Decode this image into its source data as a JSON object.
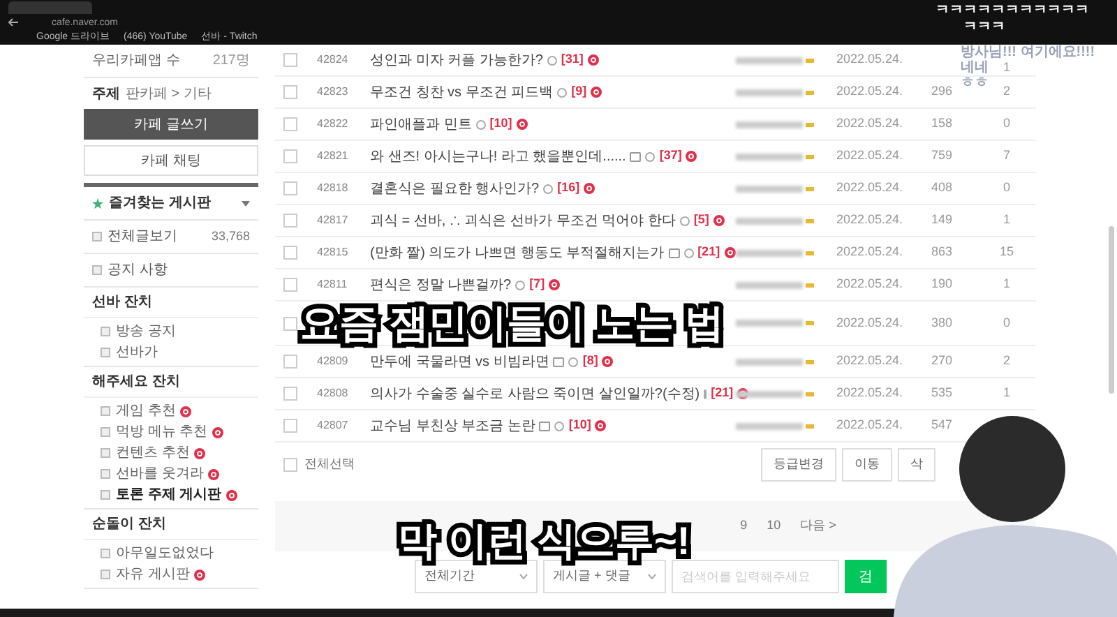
{
  "browser": {
    "url": "cafe.naver.com",
    "bookmarks": [
      "Google 드라이브",
      "(466) YouTube",
      "선바 - Twitch"
    ]
  },
  "sidebar": {
    "member_count": {
      "label": "우리카페앱 수",
      "value": "217명"
    },
    "topic": {
      "label": "주제",
      "value": "판카페 > 기타"
    },
    "buttons": [
      {
        "label": "카페 글쓰기",
        "kind": "primary"
      },
      {
        "label": "카페 채팅",
        "kind": "secondary"
      }
    ],
    "favorites": {
      "label": "즐겨찾는 게시판",
      "expanded": true
    },
    "top_items": [
      {
        "label": "전체글보기",
        "count": "33,768"
      },
      {
        "label": "공지 사항"
      }
    ],
    "sections": [
      {
        "title": "선바 잔치",
        "items": [
          {
            "label": "방송 공지",
            "new": false,
            "selected": false
          },
          {
            "label": "선바가",
            "new": false,
            "selected": false
          }
        ]
      },
      {
        "title": "해주세요 잔치",
        "items": [
          {
            "label": "게임 추천",
            "new": true,
            "selected": false
          },
          {
            "label": "먹방 메뉴 추천",
            "new": true,
            "selected": false
          },
          {
            "label": "컨텐츠 추천",
            "new": true,
            "selected": false
          },
          {
            "label": "선바를 웃겨라",
            "new": true,
            "selected": false
          },
          {
            "label": "토론 주제 게시판",
            "new": true,
            "selected": true
          }
        ]
      },
      {
        "title": "순돌이 잔치",
        "items": [
          {
            "label": "아무일도없었다",
            "new": false,
            "selected": false
          },
          {
            "label": "자유 게시판",
            "new": true,
            "selected": false
          }
        ]
      }
    ]
  },
  "posts": [
    {
      "number": "42824",
      "title": "성인과 미자 커플 가능한가?",
      "comments": "[31]",
      "new": true,
      "image": false,
      "date": "2022.05.24.",
      "likes": "1",
      "checked": false
    },
    {
      "number": "42823",
      "title": "무조건 칭찬 vs 무조건 피드백",
      "comments": "[9]",
      "new": true,
      "image": false,
      "date": "2022.05.24.",
      "views": "296",
      "likes": "2",
      "checked": false
    },
    {
      "number": "42822",
      "title": "파인애플과 민트",
      "comments": "[10]",
      "new": true,
      "image": false,
      "date": "2022.05.24.",
      "views": "158",
      "likes": "0",
      "checked": false
    },
    {
      "number": "42821",
      "title": "와 샌즈! 아시는구나! 라고 했을뿐인데......",
      "comments": "[37]",
      "new": true,
      "image": true,
      "date": "2022.05.24.",
      "views": "759",
      "likes": "7",
      "checked": false
    },
    {
      "number": "42818",
      "title": "결혼식은 필요한 행사인가?",
      "comments": "[16]",
      "new": true,
      "image": false,
      "date": "2022.05.24.",
      "views": "408",
      "likes": "0",
      "checked": false
    },
    {
      "number": "42817",
      "title": "괴식 = 선바, ∴ 괴식은 선바가 무조건 먹어야 한다",
      "comments": "[5]",
      "new": true,
      "image": false,
      "date": "2022.05.24.",
      "views": "149",
      "likes": "1",
      "checked": false
    },
    {
      "number": "42815",
      "title": "(만화 짤) 의도가 나쁘면 행동도 부적절해지는가",
      "comments": "[21]",
      "new": true,
      "image": true,
      "date": "2022.05.24.",
      "views": "863",
      "likes": "15",
      "checked": false
    },
    {
      "number": "42811",
      "title": "편식은 정말 나쁜걸까?",
      "comments": "[7]",
      "new": true,
      "image": false,
      "date": "2022.05.24.",
      "views": "190",
      "likes": "1",
      "checked": false
    },
    {
      "date": "2022.05.24.",
      "views": "380",
      "likes": "0",
      "checked": false
    },
    {
      "number": "42809",
      "title": "만두에 국물라면 vs 비빔라면",
      "comments": "[8]",
      "new": true,
      "image": true,
      "date": "2022.05.24.",
      "views": "270",
      "likes": "2",
      "checked": false
    },
    {
      "number": "42808",
      "title": "의사가 수술중 실수로 사람으 죽이면 살인일까?(수정)",
      "comments": "[21]",
      "new": true,
      "image": false,
      "date": "2022.05.24.",
      "views": "535",
      "likes": "1",
      "checked": false
    },
    {
      "number": "42807",
      "title": "교수님 부친상 부조금 논란",
      "comments": "[10]",
      "new": true,
      "image": true,
      "date": "2022.05.24.",
      "views": "547",
      "checked": false
    }
  ],
  "select_all": {
    "label": "전체선택",
    "checked": false
  },
  "actions": [
    "등급변경",
    "이동",
    "삭"
  ],
  "pagination": {
    "pages": [
      "9",
      "10"
    ],
    "next": "다음 >"
  },
  "search": {
    "period": "전체기간",
    "scope": "게시글 + 댓글",
    "placeholder": "검색어를 입력해주세요",
    "button": "검"
  },
  "chat": [
    "ㅋㅋㅋㅋㅋㅋㅋㅋㅋㅋㅋ",
    "ㅋㅋㅋ",
    "방사님!!! 여기에요!!!!",
    "네네",
    "ㅎㅎ"
  ],
  "subtitles": [
    "요즘 잼민이들이 노는 법",
    "막 이런 식으루~!"
  ]
}
